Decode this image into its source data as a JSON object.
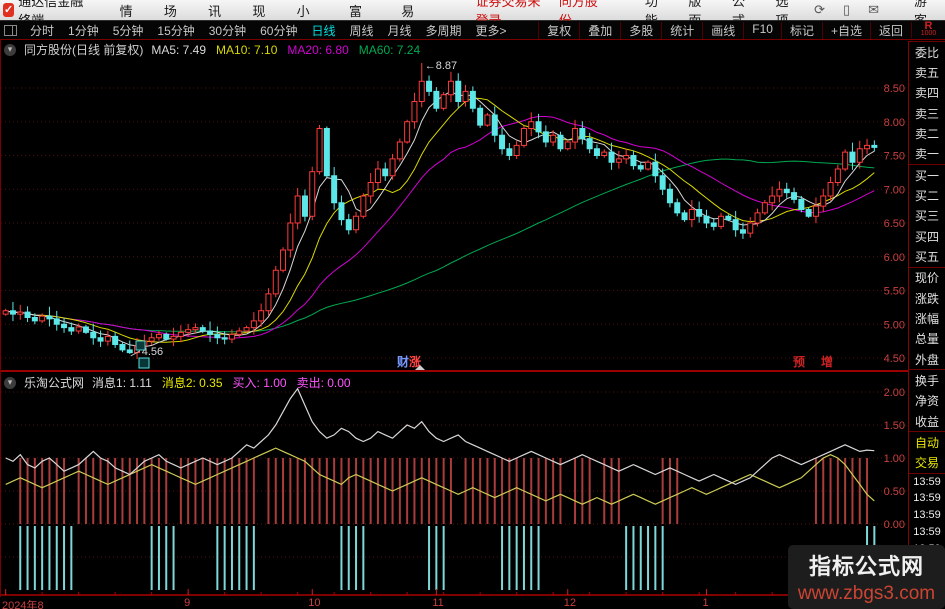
{
  "app": {
    "title": "通达信金融终端",
    "menus_left": [
      "行情",
      "市场",
      "资讯",
      "发现",
      "问小达",
      "财富圈",
      "交易"
    ],
    "login_status": "证券交易未登录",
    "stock_name_top": "同方股份",
    "menus_right": [
      "功能",
      "版面",
      "公式",
      "选项"
    ],
    "icons": [
      "refresh-icon",
      "mobile-icon",
      "mail-icon"
    ],
    "icon_glyphs": [
      "⟳",
      "▯",
      "✉"
    ],
    "user": "游客"
  },
  "period_bar": {
    "items": [
      "分时",
      "1分钟",
      "5分钟",
      "15分钟",
      "30分钟",
      "60分钟",
      "日线",
      "周线",
      "月线",
      "多周期",
      "更多>"
    ],
    "active": "日线",
    "right_items": [
      "复权",
      "叠加",
      "多股",
      "统计",
      "画线",
      "F10",
      "标记",
      "+自选",
      "返回"
    ],
    "marker": "R",
    "marker_sub": "1000"
  },
  "main_chart": {
    "title": "同方股份(日线 前复权)",
    "ma_labels": [
      {
        "label": "MA5: 7.49",
        "color": "#d8d8d8"
      },
      {
        "label": "MA10: 7.10",
        "color": "#d8d800"
      },
      {
        "label": "MA20: 6.80",
        "color": "#d400d4"
      },
      {
        "label": "MA60: 7.24",
        "color": "#00aa50"
      }
    ],
    "high_label": "8.87",
    "low_label": "4.56",
    "event_marker_chars": [
      {
        "text": "财",
        "color": "#7799ff"
      },
      {
        "text": "涨",
        "color": "#ff4444"
      }
    ],
    "news_marker_chars": [
      {
        "text": "预",
        "color": "#cc2222"
      },
      {
        "text": "增",
        "color": "#cc2222"
      }
    ]
  },
  "indicator_panel": {
    "title": "乐淘公式网",
    "labels": [
      {
        "text": "消息1: 1.11",
        "color": "#dcdcdc"
      },
      {
        "text": "消息2: 0.35",
        "color": "#e8e800"
      },
      {
        "text": "买入: 1.00",
        "color": "#ff55ff"
      },
      {
        "text": "卖出: 0.00",
        "color": "#ff55ff"
      }
    ]
  },
  "sidebar": {
    "items": [
      {
        "t": "委比",
        "sep": true
      },
      {
        "t": "卖五"
      },
      {
        "t": "卖四"
      },
      {
        "t": "卖三"
      },
      {
        "t": "卖二"
      },
      {
        "t": "卖一"
      },
      {
        "t": "买一",
        "sep": true
      },
      {
        "t": "买二"
      },
      {
        "t": "买三"
      },
      {
        "t": "买四"
      },
      {
        "t": "买五"
      },
      {
        "t": "现价",
        "sep": true
      },
      {
        "t": "涨跌"
      },
      {
        "t": "涨幅"
      },
      {
        "t": "总量"
      },
      {
        "t": "外盘"
      },
      {
        "t": "换手",
        "sep": true
      },
      {
        "t": "净资"
      },
      {
        "t": "收益"
      },
      {
        "t": "自动",
        "sep": true,
        "tab": true
      },
      {
        "t": "交易",
        "tab": true
      }
    ],
    "times": [
      "13:59",
      "13:59",
      "13:59",
      "13:59",
      "13:59",
      "13:59",
      "13:59",
      "13:59"
    ]
  },
  "watermark": {
    "line1": "指标公式网",
    "line2": "www.zbgs3.com"
  },
  "colors": {
    "up": "#ff3b3b",
    "down": "#5ce8e8",
    "ma5": "#d8d8d8",
    "ma10": "#d8d800",
    "ma20": "#d400d4",
    "ma60": "#00aa50",
    "grid": "#4a1111",
    "axis_text": "#c84040",
    "frame": "#9b0000",
    "buy_bar": "#aa3c3c",
    "sell_bar": "#7fd8d8",
    "msg1": "#d8d8d8",
    "msg2": "#cccc55"
  },
  "chart_data": {
    "type": "candlestick",
    "title": "同方股份 日线 前复权",
    "bars": 120,
    "main": {
      "closes": [
        5.2,
        5.15,
        5.18,
        5.1,
        5.05,
        5.12,
        5.08,
        5.0,
        4.95,
        4.9,
        4.96,
        4.88,
        4.8,
        4.75,
        4.82,
        4.7,
        4.62,
        4.58,
        4.68,
        4.75,
        4.8,
        4.85,
        4.78,
        4.82,
        4.88,
        4.92,
        4.95,
        4.9,
        4.85,
        4.8,
        4.78,
        4.85,
        4.9,
        4.95,
        5.05,
        5.2,
        5.45,
        5.8,
        6.1,
        6.5,
        6.9,
        6.6,
        7.26,
        7.9,
        7.2,
        6.8,
        6.55,
        6.4,
        6.6,
        6.9,
        7.1,
        7.3,
        7.2,
        7.45,
        7.7,
        8.0,
        8.3,
        8.6,
        8.45,
        8.2,
        8.4,
        8.6,
        8.3,
        8.45,
        8.2,
        7.95,
        8.1,
        7.8,
        7.6,
        7.5,
        7.65,
        7.9,
        8.0,
        7.85,
        7.7,
        7.8,
        7.6,
        7.7,
        7.9,
        7.75,
        7.6,
        7.5,
        7.55,
        7.4,
        7.45,
        7.5,
        7.35,
        7.3,
        7.4,
        7.2,
        7.0,
        6.8,
        6.65,
        6.55,
        6.7,
        6.6,
        6.5,
        6.45,
        6.6,
        6.55,
        6.4,
        6.35,
        6.5,
        6.65,
        6.8,
        6.9,
        7.0,
        6.95,
        6.85,
        6.7,
        6.6,
        6.75,
        6.9,
        7.1,
        7.3,
        7.55,
        7.4,
        7.6,
        7.65,
        7.62
      ],
      "special_high": {
        "bar": 57,
        "value": 8.87
      },
      "special_low": {
        "bar": 17,
        "value": 4.56
      },
      "ma_periods": [
        5,
        10,
        20,
        60
      ],
      "y_ticks": [
        8.5,
        8.0,
        7.5,
        7.0,
        6.5,
        6.0,
        5.5,
        5.0,
        4.5
      ],
      "y_tick_labels": [
        "8.50",
        "8.00",
        "7.50",
        "7.00",
        "6.50",
        "6.00",
        "5.50",
        "5.00",
        "4.50"
      ]
    },
    "indicator": {
      "y_ticks": [
        2.0,
        1.5,
        1.0,
        0.5,
        0.0,
        -0.5
      ],
      "y_tick_labels": [
        "2.00",
        "1.50",
        "1.00",
        "0.50",
        "0.00",
        "0.50"
      ],
      "msg1": [
        1.0,
        0.95,
        1.05,
        0.9,
        0.85,
        0.95,
        1.0,
        0.9,
        0.8,
        0.85,
        0.9,
        1.0,
        1.1,
        1.0,
        0.95,
        0.85,
        0.8,
        0.75,
        0.85,
        0.95,
        1.0,
        1.05,
        0.95,
        0.9,
        0.85,
        0.9,
        0.95,
        1.0,
        0.95,
        0.9,
        0.95,
        1.0,
        1.1,
        1.2,
        1.15,
        1.25,
        1.35,
        1.5,
        1.7,
        1.9,
        2.05,
        1.8,
        1.55,
        1.4,
        1.3,
        1.35,
        1.45,
        1.4,
        1.3,
        1.25,
        1.3,
        1.4,
        1.35,
        1.3,
        1.4,
        1.5,
        1.45,
        1.55,
        1.4,
        1.3,
        1.25,
        1.3,
        1.35,
        1.25,
        1.2,
        1.15,
        1.1,
        1.05,
        1.0,
        0.95,
        1.0,
        1.05,
        1.1,
        1.05,
        1.0,
        0.95,
        0.9,
        0.95,
        1.0,
        1.05,
        1.0,
        0.95,
        0.9,
        0.85,
        0.8,
        0.85,
        0.9,
        0.85,
        0.8,
        0.75,
        0.8,
        0.85,
        0.8,
        0.75,
        0.7,
        0.65,
        0.7,
        0.75,
        0.7,
        0.65,
        0.6,
        0.65,
        0.7,
        0.8,
        0.9,
        1.0,
        1.05,
        1.0,
        0.95,
        0.9,
        0.95,
        1.0,
        1.05,
        1.1,
        1.15,
        1.2,
        1.15,
        1.1,
        1.12,
        1.11
      ],
      "msg2": [
        0.6,
        0.65,
        0.7,
        0.65,
        0.6,
        0.55,
        0.6,
        0.65,
        0.7,
        0.75,
        0.8,
        0.75,
        0.7,
        0.65,
        0.6,
        0.65,
        0.7,
        0.75,
        0.8,
        0.85,
        0.9,
        0.85,
        0.8,
        0.75,
        0.7,
        0.65,
        0.6,
        0.65,
        0.7,
        0.75,
        0.8,
        0.85,
        0.9,
        0.95,
        1.0,
        1.05,
        1.1,
        1.15,
        1.1,
        1.05,
        1.0,
        0.95,
        0.85,
        0.75,
        0.7,
        0.65,
        0.6,
        0.7,
        0.75,
        0.7,
        0.65,
        0.6,
        0.55,
        0.5,
        0.55,
        0.6,
        0.65,
        0.7,
        0.65,
        0.6,
        0.55,
        0.5,
        0.45,
        0.5,
        0.55,
        0.5,
        0.45,
        0.4,
        0.45,
        0.5,
        0.55,
        0.5,
        0.45,
        0.4,
        0.35,
        0.4,
        0.45,
        0.4,
        0.35,
        0.3,
        0.35,
        0.4,
        0.35,
        0.3,
        0.35,
        0.4,
        0.45,
        0.4,
        0.35,
        0.3,
        0.35,
        0.4,
        0.45,
        0.5,
        0.55,
        0.5,
        0.45,
        0.5,
        0.55,
        0.6,
        0.65,
        0.7,
        0.75,
        0.7,
        0.65,
        0.6,
        0.55,
        0.6,
        0.65,
        0.7,
        0.8,
        0.9,
        1.0,
        1.05,
        1.0,
        0.9,
        0.75,
        0.6,
        0.45,
        0.35
      ],
      "buy_signal_bar_ranges": [
        [
          2,
          8
        ],
        [
          10,
          22
        ],
        [
          24,
          34
        ],
        [
          36,
          61
        ],
        [
          63,
          76
        ],
        [
          78,
          80
        ],
        [
          82,
          84
        ],
        [
          90,
          92
        ],
        [
          111,
          118
        ]
      ],
      "sell_signal_bar_ranges": [
        [
          2,
          9
        ],
        [
          20,
          23
        ],
        [
          29,
          34
        ],
        [
          46,
          49
        ],
        [
          58,
          60
        ],
        [
          68,
          73
        ],
        [
          85,
          90
        ],
        [
          118,
          119
        ]
      ]
    },
    "x_ticks": [
      {
        "label": "2024年8",
        "bar": 0
      },
      {
        "label": "9",
        "bar": 25
      },
      {
        "label": "10",
        "bar": 42
      },
      {
        "label": "11",
        "bar": 59
      },
      {
        "label": "12",
        "bar": 77
      },
      {
        "label": "1",
        "bar": 96
      }
    ]
  }
}
